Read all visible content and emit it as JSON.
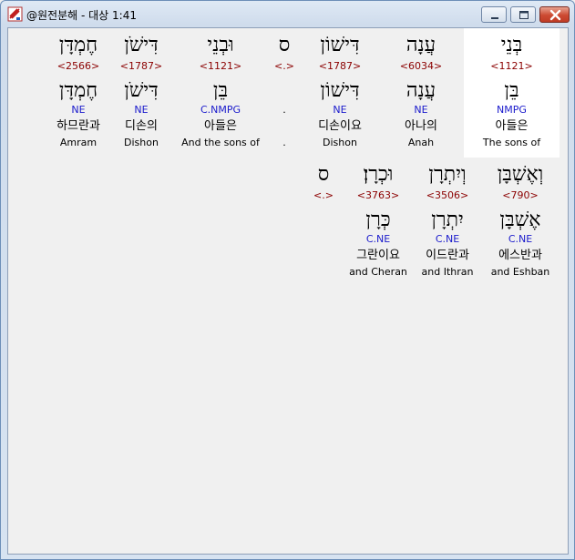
{
  "window": {
    "title": "@원전분해 - 대상 1:41",
    "buttons": {
      "minimize": "minimize-icon",
      "maximize": "maximize-icon",
      "close": "close-icon"
    }
  },
  "rows": [
    [
      {
        "hebrew": "בְּנֵי",
        "strong": "<1121>",
        "root": "בֵּן",
        "morph": "NMPG",
        "korean": "아들은",
        "english": "The sons of",
        "highlight": true
      },
      {
        "hebrew": "עֲנָה",
        "strong": "<6034>",
        "root": "עֲנָה",
        "morph": "NE",
        "korean": "아나의",
        "english": "Anah"
      },
      {
        "hebrew": "דִּישׁוֹן",
        "strong": "<1787>",
        "root": "דִּישׁוֹן",
        "morph": "NE",
        "korean": "디손이요",
        "english": "Dishon"
      },
      {
        "hebrew": "ס",
        "strong": "<.>",
        "root": "",
        "morph": ".",
        "korean": "",
        "english": "."
      },
      {
        "hebrew": "וּבְנֵי",
        "strong": "<1121>",
        "root": "בֵּן",
        "morph": "C.NMPG",
        "korean": "아들은",
        "english": "And the sons of"
      },
      {
        "hebrew": "דִּישֹׁן",
        "strong": "<1787>",
        "root": "דִּישֹׁן",
        "morph": "NE",
        "korean": "디손의",
        "english": "Dishon"
      },
      {
        "hebrew": "חֶמְדָּן",
        "strong": "<2566>",
        "root": "חֶמְדָּן",
        "morph": "NE",
        "korean": "하므란과",
        "english": "Amram"
      }
    ],
    [
      {
        "hebrew": "וְאֶשְׁבָּן",
        "strong": "<790>",
        "root": "אֶשְׁבָּן",
        "morph": "C.NE",
        "korean": "에스반과",
        "english": "and Eshban"
      },
      {
        "hebrew": "וְיִתְרָן",
        "strong": "<3506>",
        "root": "יִתְרָן",
        "morph": "C.NE",
        "korean": "이드란과",
        "english": "and Ithran"
      },
      {
        "hebrew": "וּכְרָן׃",
        "strong": "<3763>",
        "root": "כְּרָן",
        "morph": "C.NE",
        "korean": "그란이요",
        "english": "and Cheran"
      },
      {
        "hebrew": "ס",
        "strong": "<.>",
        "root": "",
        "morph": "",
        "korean": "",
        "english": ""
      }
    ]
  ]
}
